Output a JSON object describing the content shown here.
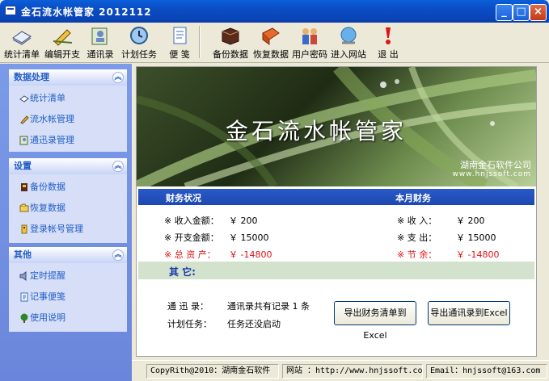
{
  "window": {
    "title": "金石流水帐管家  2012112",
    "minimize_glyph": "_",
    "maximize_glyph": "□",
    "close_glyph": "×"
  },
  "toolbar": [
    {
      "label": "统计清单",
      "icon": "notebook-icon"
    },
    {
      "label": "编辑开支",
      "icon": "pencil-icon"
    },
    {
      "label": "通讯录",
      "icon": "contacts-icon"
    },
    {
      "label": "计划任务",
      "icon": "clock-icon"
    },
    {
      "label": "便 笺",
      "icon": "note-icon"
    },
    {
      "label": "备份数据",
      "icon": "backup-icon"
    },
    {
      "label": "恢复数据",
      "icon": "restore-icon"
    },
    {
      "label": "用户密码",
      "icon": "users-icon"
    },
    {
      "label": "进入网站",
      "icon": "globe-icon"
    },
    {
      "label": "退 出",
      "icon": "exit-icon"
    }
  ],
  "sidebar": {
    "data_panel": {
      "title": "数据处理",
      "items": [
        "统计清单",
        "流水帐管理",
        "通迅录管理"
      ]
    },
    "settings_panel": {
      "title": "设置",
      "items": [
        "备份数据",
        "恢复数据",
        "登录帐号管理"
      ]
    },
    "other_panel": {
      "title": "其他",
      "items": [
        "定时提醒",
        "记事便笺",
        "使用说明"
      ]
    }
  },
  "banner": {
    "title": "金石流水帐管家",
    "company": "湖南金石软件公司",
    "url": "www.hnjssoft.com"
  },
  "finance": {
    "left_header": "财务状况",
    "right_header": "本月财务",
    "left": {
      "income_label": "※ 收入金额：",
      "income_value": "￥  200",
      "expense_label": "※ 开支金额：",
      "expense_value": "￥  15000",
      "total_label": "※ 总 资 产：",
      "total_value": "￥  -14800"
    },
    "right": {
      "income_label": "※ 收   入：",
      "income_value": "￥  200",
      "expense_label": "※ 支   出：",
      "expense_value": "￥  15000",
      "save_label": "※ 节   余：",
      "save_value": "￥  -14800"
    }
  },
  "other": {
    "header": "其 它:",
    "contacts_label": "通 迅 录：",
    "contacts_value": "通讯录共有记录 1 条",
    "tasks_label": "计划任务：",
    "tasks_value": "任务还没启动",
    "export_finance_button": "导出财务清单到Excel",
    "export_contacts_button": "导出通讯录到Excel"
  },
  "statusbar": {
    "copyright": "CopyRith@2010：湖南金石软件",
    "website": "网站 ：http://www.hnjssoft.com",
    "email": "Email：hnjssoft@163.com"
  },
  "colors": {
    "titlebar": "#0a4cc4",
    "sidebar": "#7b9be8",
    "panel_text": "#215dc6",
    "finance_header": "#1c48b0",
    "negative": "#e01010",
    "other_bar": "#d3e2cd"
  }
}
